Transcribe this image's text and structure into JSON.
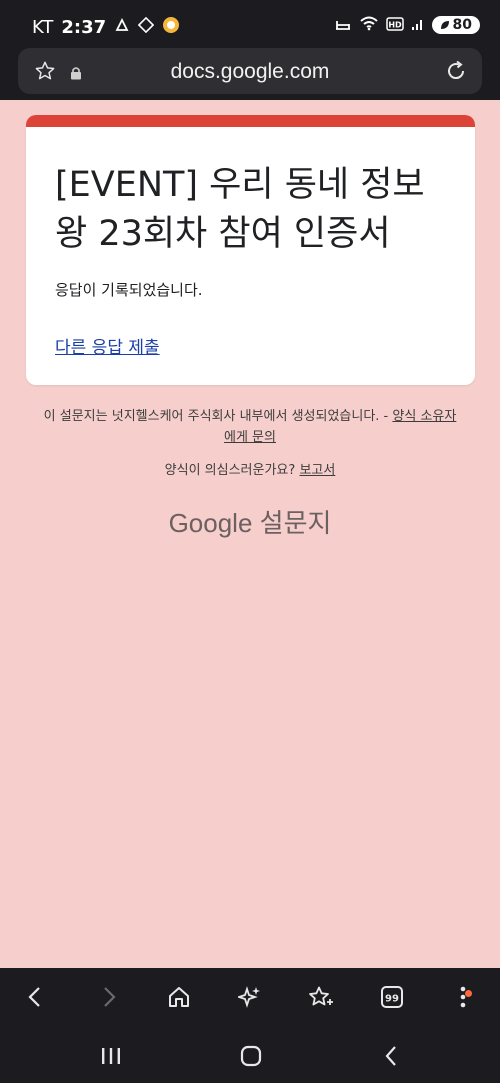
{
  "status_bar": {
    "carrier": "KT",
    "time": "2:37",
    "battery": "80"
  },
  "browser": {
    "url": "docs.google.com"
  },
  "form": {
    "title": "[EVENT] 우리 동네 정보왕 23회차 참여 인증서",
    "confirmation": "응답이 기록되었습니다.",
    "submit_another": "다른 응답 제출"
  },
  "footer": {
    "created_by": "이 설문지는 넛지헬스케어 주식회사 내부에서 생성되었습니다. -",
    "contact_owner": "양식 소유자에게 문의",
    "suspicious": "양식이 의심스러운가요?",
    "report": "보고서",
    "brand_google": "Google",
    "brand_forms": "설문지"
  },
  "colors": {
    "background": "#f6cfcd",
    "accent": "#db4437",
    "link": "#1a3fa6",
    "notification": "#ff6a3d"
  }
}
